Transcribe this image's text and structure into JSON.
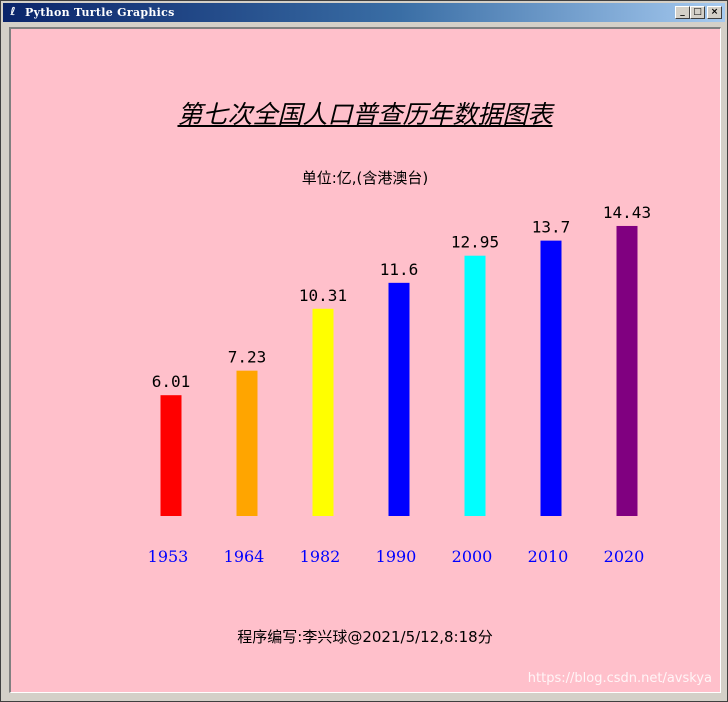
{
  "window": {
    "title": "Python Turtle Graphics",
    "icon": "feather-icon",
    "controls": {
      "minimize": "_",
      "maximize": "□",
      "close": "×"
    }
  },
  "canvas": {
    "background": "#ffc0cb"
  },
  "chart_data": {
    "type": "bar",
    "title": "第七次全国人口普查历年数据图表",
    "subtitle": "单位:亿,(含港澳台)",
    "footer": "程序编写:李兴球@2021/5/12,8:18分",
    "categories": [
      "1953",
      "1964",
      "1982",
      "1990",
      "2000",
      "2010",
      "2020"
    ],
    "values": [
      6.01,
      7.23,
      10.31,
      11.6,
      12.95,
      13.7,
      14.43
    ],
    "value_labels": [
      "6.01",
      "7.23",
      "10.31",
      "11.6",
      "12.95",
      "13.7",
      "14.43"
    ],
    "colors": [
      "#ff0000",
      "#ffa500",
      "#ffff00",
      "#0000ff",
      "#00ffff",
      "#0000ff",
      "#800080"
    ],
    "category_label_color": "#0000ff",
    "grid": false,
    "legend": "none"
  },
  "watermark": "https://blog.csdn.net/avskya"
}
